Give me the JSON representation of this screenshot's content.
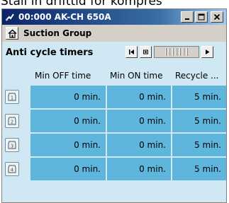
{
  "top_text": "Stall in drifttid for kompres",
  "window": {
    "title": "00:000 AK-CH 650A",
    "buttons": [
      "_",
      "□",
      "×"
    ]
  },
  "group": {
    "label": "Suction Group",
    "icon": "home-icon"
  },
  "timers": {
    "label": "Anti cycle timers",
    "nav_icons": [
      "first-page-icon",
      "previous-icon",
      "page-slider-icon",
      "next-icon"
    ]
  },
  "columns": [
    "Min OFF time",
    "Min ON time",
    "Recycle ..."
  ],
  "rows": [
    {
      "index": "1",
      "values": [
        "0 min.",
        "0 min.",
        "5 min."
      ]
    },
    {
      "index": "2",
      "values": [
        "0 min.",
        "0 min.",
        "5 min."
      ]
    },
    {
      "index": "3",
      "values": [
        "0 min.",
        "0 min.",
        "5 min."
      ]
    },
    {
      "index": "4",
      "values": [
        "0 min.",
        "0 min.",
        "5 min."
      ]
    }
  ],
  "colors": {
    "title_bar": "#0a246a",
    "content_bg": "#cfe8f3",
    "cell_bg": "#5fb6dd"
  }
}
